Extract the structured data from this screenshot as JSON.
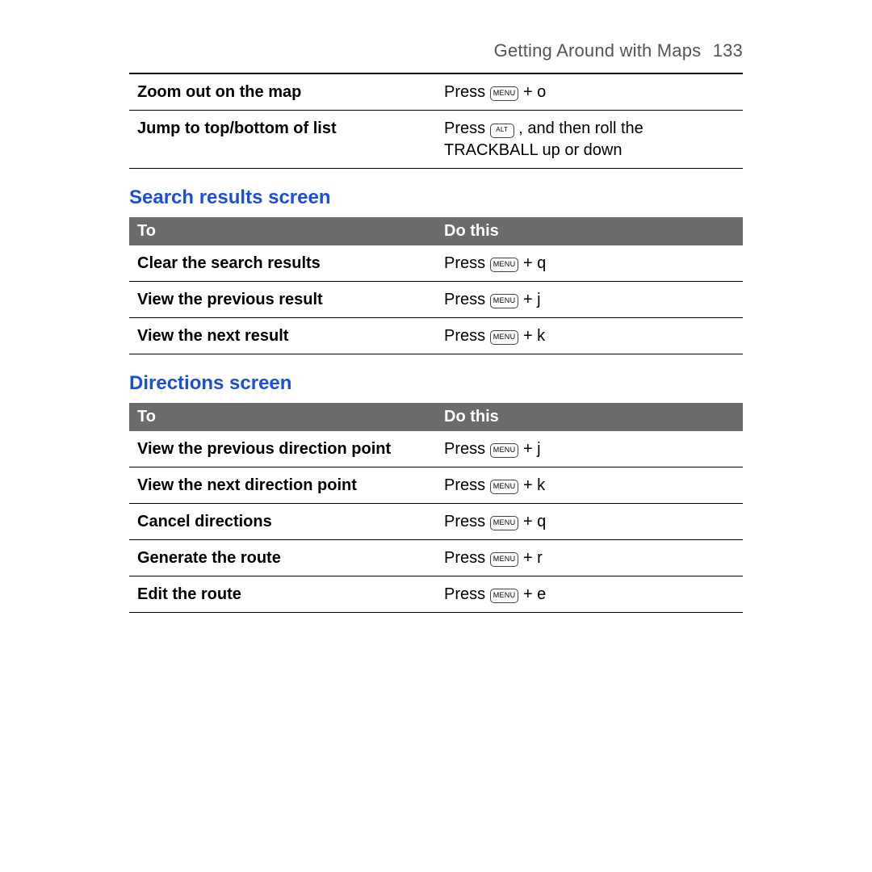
{
  "header": {
    "chapter": "Getting Around with Maps",
    "page": "133"
  },
  "topRows": [
    {
      "action": "Zoom out on the map",
      "doit_pre": "Press ",
      "key": "MENU",
      "doit_post": " + o"
    },
    {
      "action": "Jump to top/bottom of list",
      "doit_pre": "Press ",
      "key": "ALT",
      "doit_post": " , and then roll the TRACKBALL up or down"
    }
  ],
  "sections": [
    {
      "heading": "Search results screen",
      "thead": {
        "to": "To",
        "dothis": "Do this"
      },
      "rows": [
        {
          "action": "Clear the search results",
          "doit_pre": "Press ",
          "key": "MENU",
          "doit_post": " + q"
        },
        {
          "action": "View the previous result",
          "doit_pre": "Press ",
          "key": "MENU",
          "doit_post": " + j"
        },
        {
          "action": "View the next result",
          "doit_pre": "Press ",
          "key": "MENU",
          "doit_post": " + k"
        }
      ]
    },
    {
      "heading": "Directions screen",
      "thead": {
        "to": "To",
        "dothis": "Do this"
      },
      "rows": [
        {
          "action": "View the previous direction point",
          "doit_pre": "Press ",
          "key": "MENU",
          "doit_post": " + j"
        },
        {
          "action": "View the next direction point",
          "doit_pre": "Press ",
          "key": "MENU",
          "doit_post": " + k"
        },
        {
          "action": "Cancel directions",
          "doit_pre": "Press ",
          "key": "MENU",
          "doit_post": " + q"
        },
        {
          "action": "Generate the route",
          "doit_pre": "Press ",
          "key": "MENU",
          "doit_post": " + r"
        },
        {
          "action": "Edit the route",
          "doit_pre": "Press ",
          "key": "MENU",
          "doit_post": " + e"
        }
      ]
    }
  ]
}
